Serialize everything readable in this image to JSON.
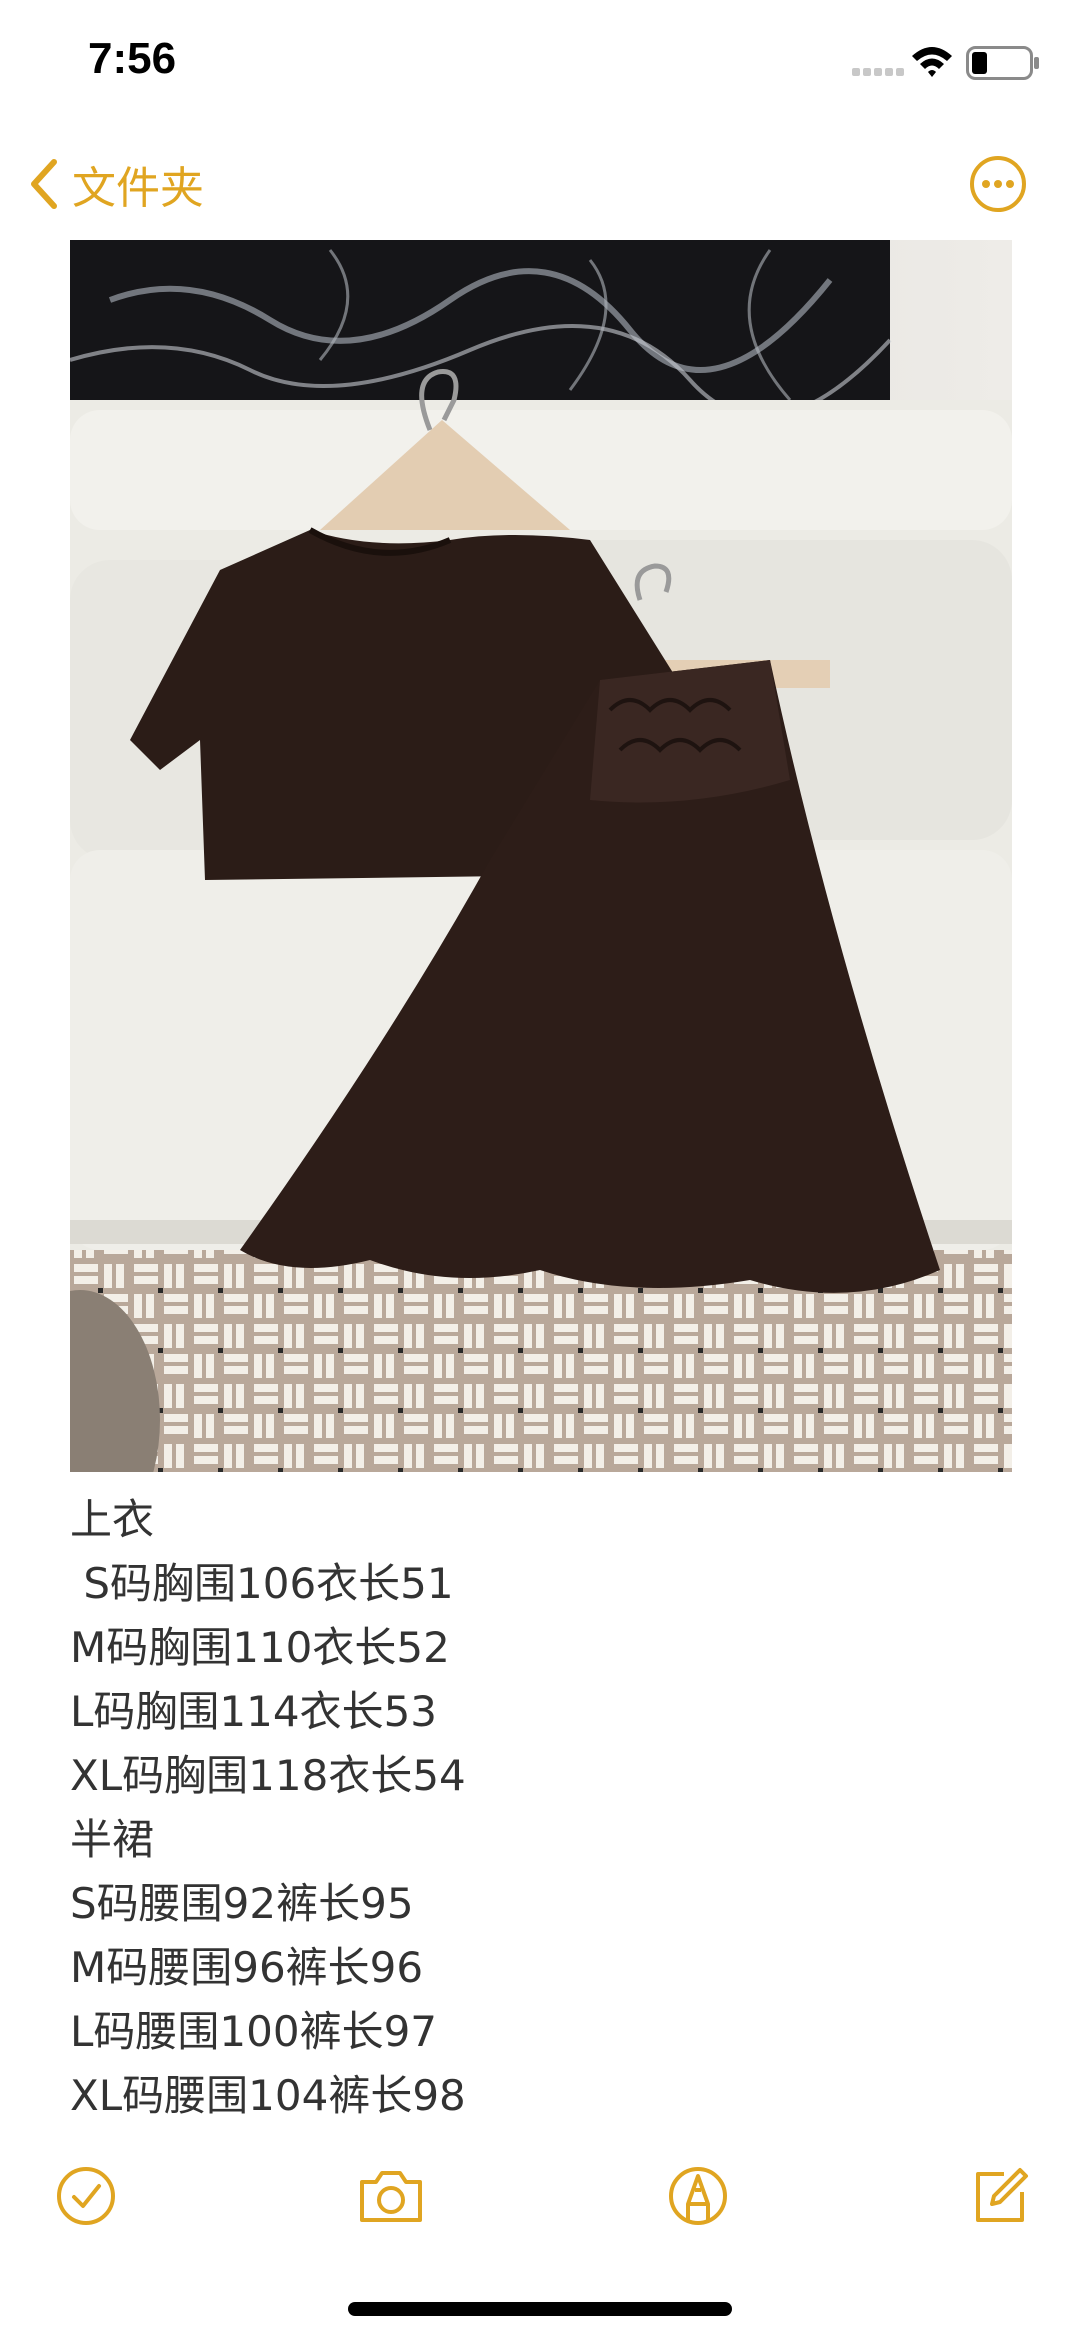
{
  "status_bar": {
    "time": "7:56",
    "icons": [
      "signal-icon",
      "wifi-icon",
      "battery-icon"
    ]
  },
  "nav": {
    "back_label": "文件夹",
    "back_icon": "chevron-left-icon",
    "more_icon": "ellipsis-circle-icon"
  },
  "note": {
    "image": "photo of dark brown short-sleeve top and skirt on hangers",
    "lines": [
      "上衣",
      " S码胸围106衣长51",
      "M码胸围110衣长52",
      "L码胸围114衣长53",
      "XL码胸围118衣长54",
      "半裙",
      "S码腰围92裤长95",
      "M码腰围96裤长96",
      "L码腰围100裤长97",
      "XL码腰围104裤长98"
    ]
  },
  "toolbar": {
    "items": [
      "checklist-icon",
      "camera-icon",
      "markup-pen-icon",
      "compose-icon"
    ]
  },
  "colors": {
    "accent": "#e0a521",
    "text": "#333333"
  }
}
